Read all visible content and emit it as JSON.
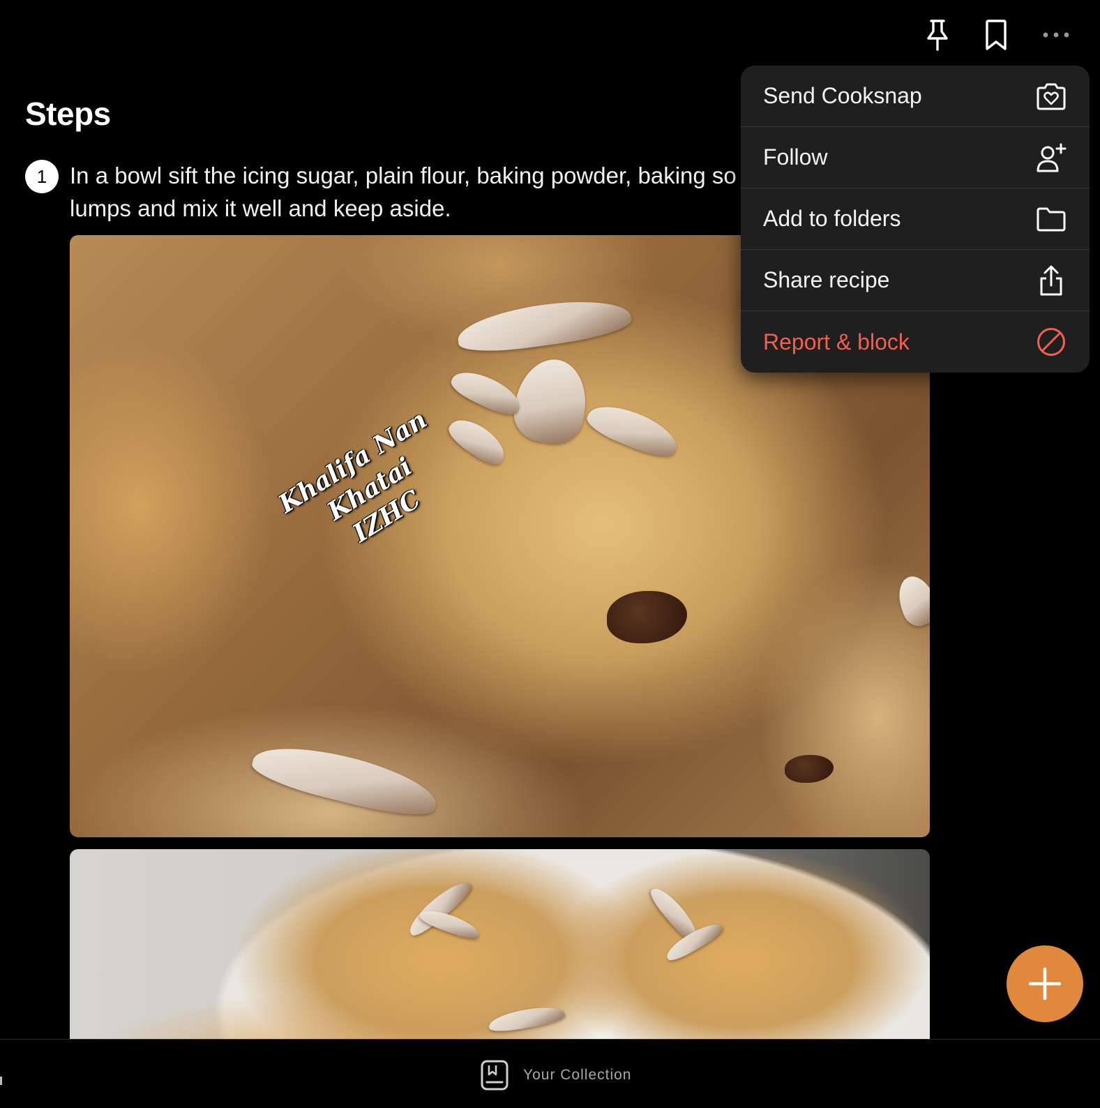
{
  "top_bar": {
    "icons": [
      "pin-icon",
      "bookmark-icon",
      "more-icon"
    ]
  },
  "steps": {
    "title": "Steps",
    "items": [
      {
        "number": "1",
        "text": "In a bowl sift the icing sugar, plain flour, baking powder, baking so that they are no lumps and mix it well and keep aside."
      }
    ],
    "photo_watermark": [
      "Khalifa Nan",
      "Khatai",
      "IZHC"
    ]
  },
  "menu": {
    "items": [
      {
        "label": "Send Cooksnap",
        "icon": "cooksnap-camera-heart-icon"
      },
      {
        "label": "Follow",
        "icon": "add-user-icon"
      },
      {
        "label": "Add to folders",
        "icon": "folder-icon"
      },
      {
        "label": "Share recipe",
        "icon": "share-icon"
      },
      {
        "label": "Report & block",
        "icon": "block-icon"
      }
    ]
  },
  "fab": {
    "icon": "plus-icon"
  },
  "bottom_bar": {
    "collection_label": "Your Collection",
    "collection_icon": "collection-book-icon"
  },
  "colors": {
    "background": "#000000",
    "menu_background": "#1f1f1f",
    "danger": "#f2604f",
    "accent": "#e0883c",
    "muted_text": "#a8a8a8"
  }
}
